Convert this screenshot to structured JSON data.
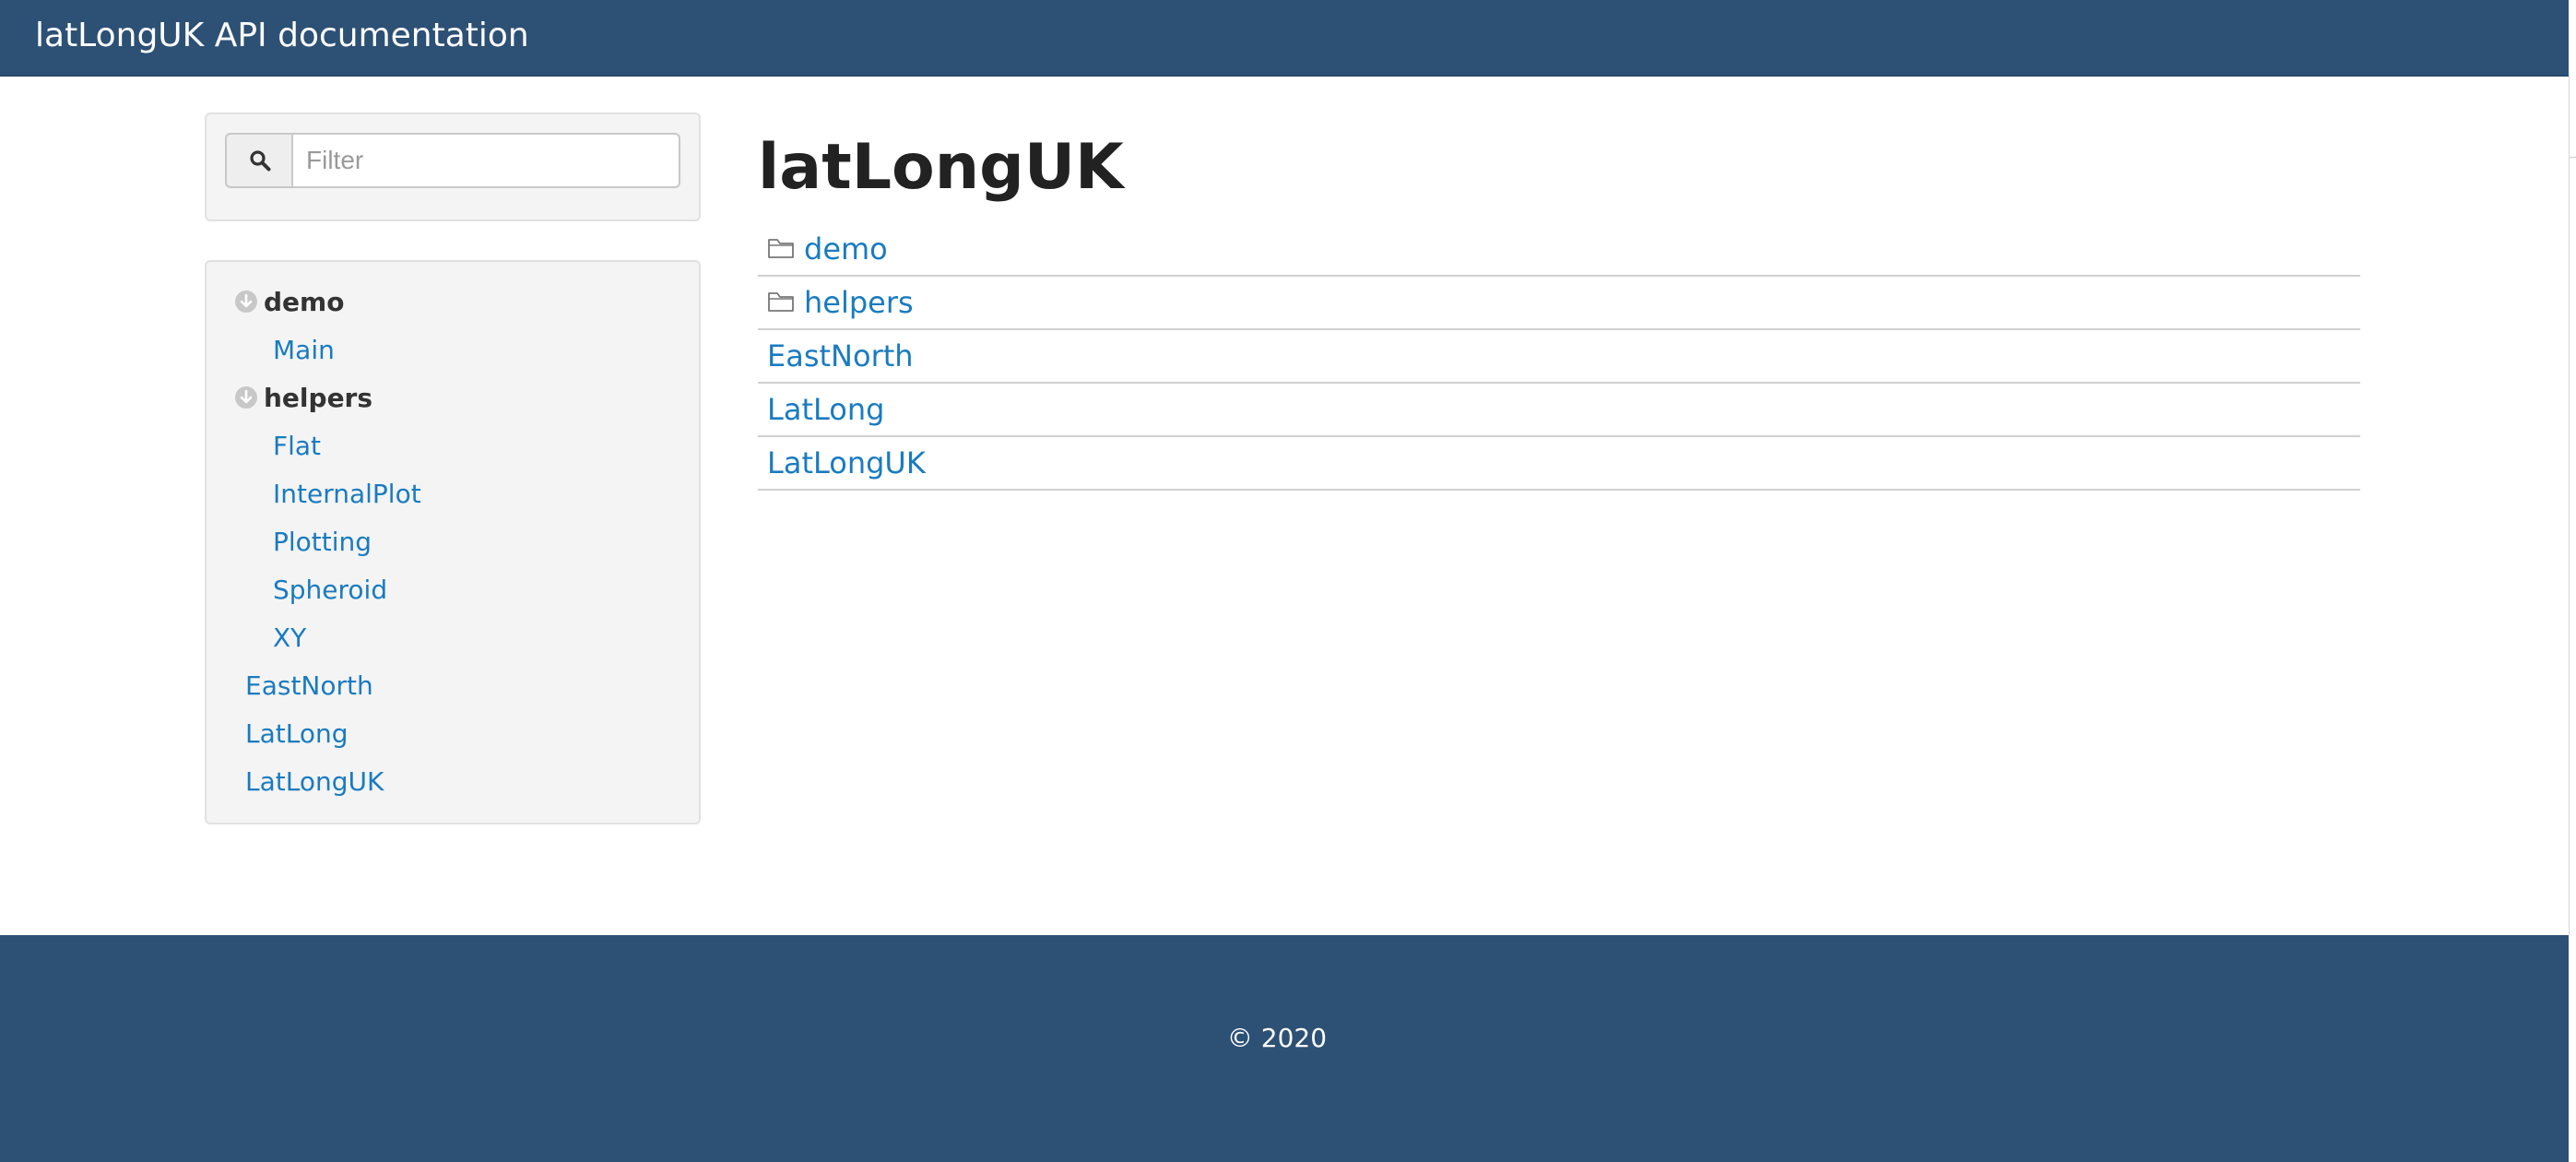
{
  "navbar": {
    "brand": "latLongUK API documentation"
  },
  "sidebar": {
    "search": {
      "placeholder": "Filter",
      "value": "",
      "icon": "search-icon"
    },
    "tree": {
      "items": [
        {
          "label": "demo",
          "kind": "folder",
          "expanded": true,
          "icon": "collapse-circle-icon"
        },
        {
          "label": "Main",
          "kind": "module",
          "parent": "demo"
        },
        {
          "label": "helpers",
          "kind": "folder",
          "expanded": true,
          "icon": "collapse-circle-icon"
        },
        {
          "label": "Flat",
          "kind": "module",
          "parent": "helpers"
        },
        {
          "label": "InternalPlot",
          "kind": "module",
          "parent": "helpers"
        },
        {
          "label": "Plotting",
          "kind": "module",
          "parent": "helpers"
        },
        {
          "label": "Spheroid",
          "kind": "module",
          "parent": "helpers"
        },
        {
          "label": "XY",
          "kind": "module",
          "parent": "helpers"
        },
        {
          "label": "EastNorth",
          "kind": "module"
        },
        {
          "label": "LatLong",
          "kind": "module"
        },
        {
          "label": "LatLongUK",
          "kind": "module"
        }
      ]
    }
  },
  "main": {
    "title": "latLongUK",
    "modules": [
      {
        "label": "demo",
        "kind": "folder",
        "icon": "folder-icon"
      },
      {
        "label": "helpers",
        "kind": "folder",
        "icon": "folder-icon"
      },
      {
        "label": "EastNorth",
        "kind": "module"
      },
      {
        "label": "LatLong",
        "kind": "module"
      },
      {
        "label": "LatLongUK",
        "kind": "module"
      }
    ]
  },
  "footer": {
    "copyright": "© 2020"
  },
  "colors": {
    "navbar": "#2d5075",
    "link": "#1a7bc0",
    "well_bg": "#f4f4f4",
    "heading": "#222222"
  }
}
